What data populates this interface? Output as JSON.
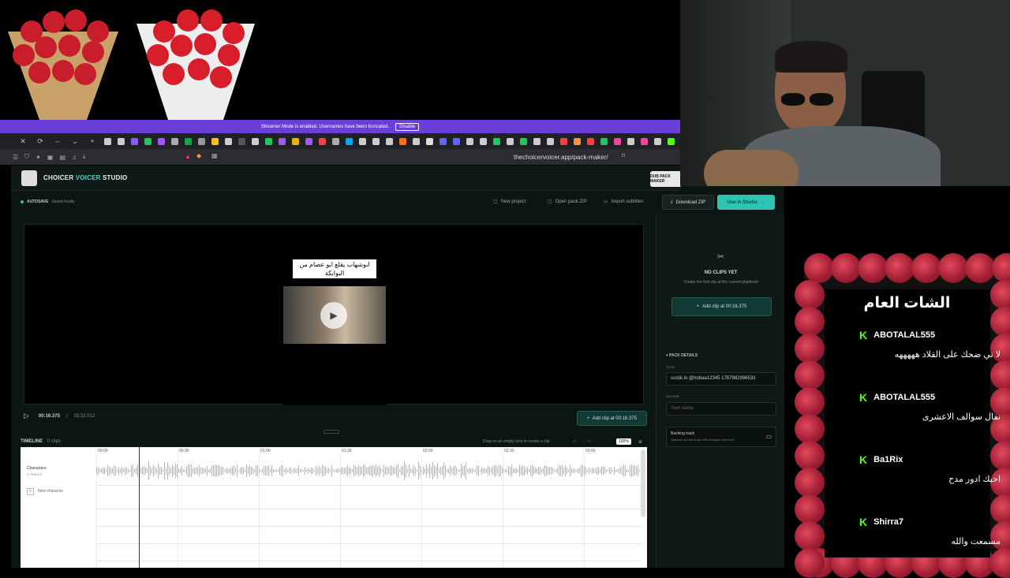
{
  "banner": {
    "text": "Streamer Mode is enabled. Usernames have been truncated.",
    "button": "Disable"
  },
  "browser": {
    "url": "thechoicervoicer.app/pack-maker/"
  },
  "app": {
    "title_part1": "CHOICER ",
    "title_part2": "VOICER",
    "title_part3": " STUDIO",
    "dub_button": "DUB PACK MAKER",
    "autosave_label": "AUTOSAVE",
    "autosave_status": "Saved locally",
    "new_project": "New project",
    "open_pack": "Open pack ZIP",
    "import_subs": "Import subtitles",
    "download_zip": "Download ZIP",
    "use_in_studio": "Use in Studio"
  },
  "preview": {
    "caption": "ابوشهاب يقلع ابو عصام من البوابكة",
    "current_time": "00:16.375",
    "total_time": "03:22.012",
    "add_clip_label": "Add clip at 00:16.375"
  },
  "panel": {
    "no_clips": "NO CLIPS YET",
    "no_clips_sub": "Create the first clip at the current playhead",
    "add_clip": "Add clip at 00:16.375",
    "pack_details": "PACK DETAILS",
    "title_label": "TITLE",
    "title_value": "ssstik.io @hobaa12345 1787982996533",
    "author_label": "AUTHOR",
    "author_placeholder": "Your name",
    "backing_label": "Backing track",
    "backing_sub": "Optional upload audio with dialogue removed"
  },
  "timeline": {
    "label": "TIMELINE",
    "clip_count": "0 clips",
    "hint": "Drag on an empty lane to create a clip",
    "zoom": "100%",
    "ticks": [
      "00:00",
      "00:30",
      "01:00",
      "01:30",
      "02:00",
      "02:30",
      "03:00"
    ],
    "track_name": "Characters",
    "track_sub": "4 TRACKS",
    "new_character": "New character"
  },
  "chat": {
    "title": "الشات العام",
    "messages": [
      {
        "user": "ABOTALAL555",
        "text": "لا ني ضحك على القلاد هههههه"
      },
      {
        "user": "ABOTALAL555",
        "text": "نقال سوالف الاعشرى"
      },
      {
        "user": "Ba1Rix",
        "text": "احبك ادور مدح"
      },
      {
        "user": "Shirra7",
        "text": "مسمعت والله"
      }
    ]
  }
}
